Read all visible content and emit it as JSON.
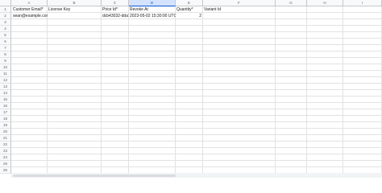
{
  "columns": [
    "A",
    "B",
    "C",
    "D",
    "E",
    "F",
    "G",
    "H",
    "I"
  ],
  "selected_column": "D",
  "rows": [
    "1",
    "2",
    "3",
    "4",
    "5",
    "6",
    "7",
    "8",
    "9",
    "10",
    "11",
    "12",
    "13",
    "14",
    "15",
    "16",
    "17",
    "18",
    "19",
    "20",
    "21",
    "22",
    "23",
    "24",
    "25",
    "26"
  ],
  "headers": {
    "customer_email": "Customer Email*",
    "license_key": "License Key",
    "price_id": "Price Id*",
    "revoke_at": "Revoke At",
    "quantity": "Quantity*",
    "variant_id": "Variant Id"
  },
  "data_row": {
    "customer_email": "sean@example.com",
    "license_key": "",
    "price_id": "dcb43032-dda7-",
    "revoke_at": "2023-05-02 15:30:00 UTC",
    "quantity": "2",
    "variant_id": ""
  }
}
